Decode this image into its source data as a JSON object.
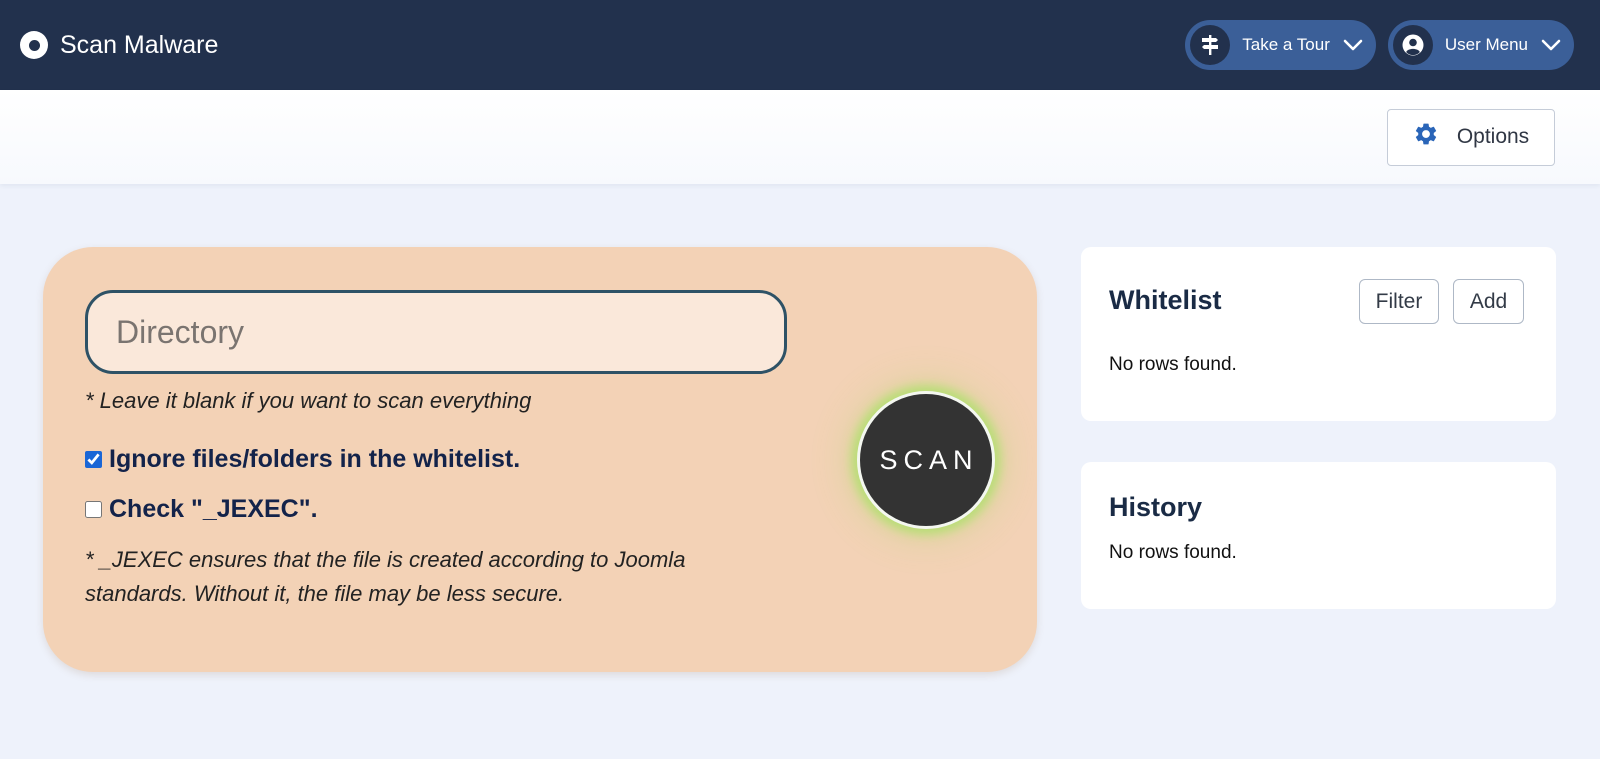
{
  "header": {
    "title": "Scan Malware",
    "tour_label": "Take a Tour",
    "user_menu_label": "User Menu"
  },
  "toolbar": {
    "options_label": "Options"
  },
  "scan": {
    "directory_placeholder": "Directory",
    "directory_value": "",
    "directory_hint": "* Leave it blank if you want to scan everything",
    "ignore_whitelist_label": "Ignore files/folders in the whitelist.",
    "ignore_whitelist_checked": true,
    "check_jexec_label": "Check \"_JEXEC\".",
    "check_jexec_checked": false,
    "jexec_hint": "* _JEXEC ensures that the file is created according to Joomla standards. Without it, the file may be less secure.",
    "scan_button_label": "SCAN"
  },
  "whitelist": {
    "title": "Whitelist",
    "filter_label": "Filter",
    "add_label": "Add",
    "empty_text": "No rows found."
  },
  "history": {
    "title": "History",
    "empty_text": "No rows found."
  },
  "icons": {
    "brand": "target-circle-icon",
    "tour": "signpost-icon",
    "user": "user-circle-icon",
    "options": "gear-icon",
    "dropdown": "chevron-down-icon"
  },
  "colors": {
    "header_bg": "#22314d",
    "pill_bg": "#3b5f98",
    "page_bg": "#eef2fb",
    "scan_card_bg": "#f3d2b6",
    "scan_button_bg": "#333333",
    "scan_glow": "#96e650",
    "accent_blue": "#1a66d6"
  }
}
